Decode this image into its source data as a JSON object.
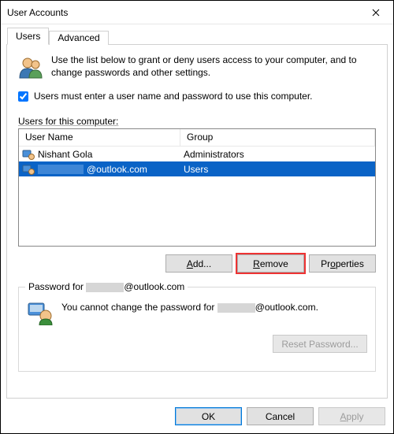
{
  "window": {
    "title": "User Accounts"
  },
  "tabs": {
    "users": "Users",
    "advanced": "Advanced"
  },
  "intro": "Use the list below to grant or deny users access to your computer, and to change passwords and other settings.",
  "checkbox": {
    "label": "Users must enter a user name and password to use this computer.",
    "checked": true
  },
  "listLabel": "sers for this computer:",
  "listLabelAccess": "U",
  "columns": {
    "c1": "User Name",
    "c2": "Group"
  },
  "rows": [
    {
      "name_prefix": "",
      "name": "Nishant Gola",
      "group": "Administrators",
      "selected": false,
      "redactedPrefix": false
    },
    {
      "name_prefix": "",
      "name": "@outlook.com",
      "group": "Users",
      "selected": true,
      "redactedPrefix": true
    }
  ],
  "buttons": {
    "add": "Add...",
    "remove": "Remove",
    "properties": "Properties"
  },
  "passwordGroup": {
    "label_prefix": "Password for ",
    "label_suffix": "@outlook.com",
    "text_prefix": "You cannot change the password for ",
    "text_suffix": "@outlook.com.",
    "reset": "Reset Password..."
  },
  "bottom": {
    "ok": "OK",
    "cancel": "Cancel",
    "apply": "Apply"
  },
  "accessKeys": {
    "add_pre": "A",
    "add_post": "dd...",
    "remove_pre": "R",
    "remove_post": "emove",
    "properties_pre": "Pr",
    "properties_mid": "o",
    "properties_post": "perties",
    "apply_pre": "A",
    "apply_post": "pply"
  }
}
